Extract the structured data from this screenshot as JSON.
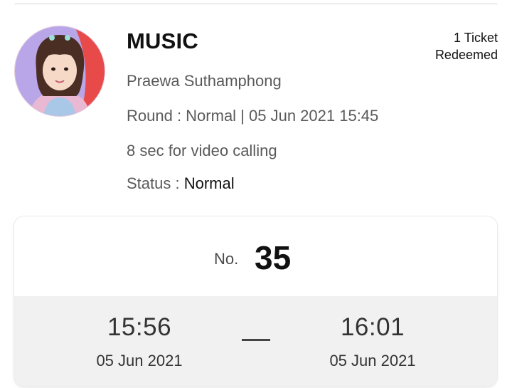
{
  "event": {
    "title": "MUSIC",
    "artist": "Praewa Suthamphong",
    "round": "Round : Normal | 05 Jun 2021 15:45",
    "call_duration": "8 sec for video calling",
    "status_label": "Status : ",
    "status_value": "Normal"
  },
  "ticket": {
    "count": "1 Ticket",
    "state": "Redeemed"
  },
  "queue": {
    "no_label": "No.",
    "number": "35",
    "start_time": "15:56",
    "start_date": "05 Jun 2021",
    "end_time": "16:01",
    "end_date": "05 Jun 2021"
  },
  "colors": {
    "avatar_background": "#b9a6e8",
    "avatar_accent": "#e84a4a",
    "card_bottom": "#f1f1f1"
  }
}
